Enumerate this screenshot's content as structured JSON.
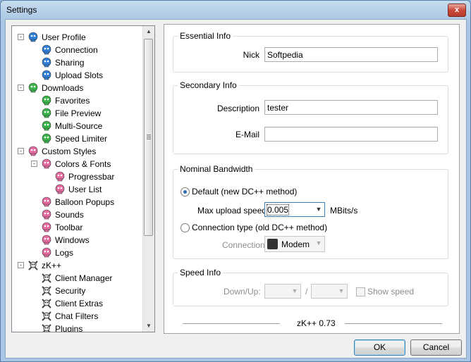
{
  "window": {
    "title": "Settings",
    "close_label": "x"
  },
  "tree": {
    "items": [
      {
        "label": "User Profile",
        "depth": 0,
        "icon": "blue-head-icon",
        "expander": "-"
      },
      {
        "label": "Connection",
        "depth": 1,
        "icon": "blue-head-icon"
      },
      {
        "label": "Sharing",
        "depth": 1,
        "icon": "blue-head-icon"
      },
      {
        "label": "Upload Slots",
        "depth": 1,
        "icon": "blue-head-icon"
      },
      {
        "label": "Downloads",
        "depth": 0,
        "icon": "green-skull-icon",
        "expander": "-"
      },
      {
        "label": "Favorites",
        "depth": 1,
        "icon": "green-skull-icon"
      },
      {
        "label": "File Preview",
        "depth": 1,
        "icon": "green-skull-icon"
      },
      {
        "label": "Multi-Source",
        "depth": 1,
        "icon": "green-skull-icon"
      },
      {
        "label": "Speed Limiter",
        "depth": 1,
        "icon": "green-skull-icon"
      },
      {
        "label": "Custom Styles",
        "depth": 0,
        "icon": "pink-skull-icon",
        "expander": "-"
      },
      {
        "label": "Colors & Fonts",
        "depth": 1,
        "icon": "pink-skull-icon",
        "expander": "-"
      },
      {
        "label": "Progressbar",
        "depth": 2,
        "icon": "pink-skull-icon"
      },
      {
        "label": "User List",
        "depth": 2,
        "icon": "pink-skull-icon"
      },
      {
        "label": "Balloon Popups",
        "depth": 1,
        "icon": "pink-skull-icon"
      },
      {
        "label": "Sounds",
        "depth": 1,
        "icon": "pink-skull-icon"
      },
      {
        "label": "Toolbar",
        "depth": 1,
        "icon": "pink-skull-icon"
      },
      {
        "label": "Windows",
        "depth": 1,
        "icon": "pink-skull-icon"
      },
      {
        "label": "Logs",
        "depth": 1,
        "icon": "pink-skull-icon"
      },
      {
        "label": "zK++",
        "depth": 0,
        "icon": "crossbones-icon",
        "expander": "-"
      },
      {
        "label": "Client Manager",
        "depth": 1,
        "icon": "crossbones-icon"
      },
      {
        "label": "Security",
        "depth": 1,
        "icon": "crossbones-icon"
      },
      {
        "label": "Client Extras",
        "depth": 1,
        "icon": "crossbones-icon"
      },
      {
        "label": "Chat Filters",
        "depth": 1,
        "icon": "crossbones-icon"
      },
      {
        "label": "Plugins",
        "depth": 1,
        "icon": "crossbones-icon"
      }
    ]
  },
  "essential": {
    "title": "Essential Info",
    "nick_label": "Nick",
    "nick_value": "Softpedia"
  },
  "secondary": {
    "title": "Secondary Info",
    "description_label": "Description",
    "description_value": "tester",
    "email_label": "E-Mail",
    "email_value": ""
  },
  "bandwidth": {
    "title": "Nominal Bandwidth",
    "default_label": "Default (new DC++ method)",
    "max_upload_label": "Max upload speed",
    "max_upload_value": "0.005",
    "units_label": "MBits/s",
    "conn_type_label": "Connection type (old DC++ method)",
    "connection_label": "Connection",
    "connection_value": "Modem"
  },
  "speed": {
    "title": "Speed Info",
    "downup_label": "Down/Up:",
    "slash": "/",
    "show_speed_label": "Show speed"
  },
  "footer": {
    "version": "zK++ 0.73"
  },
  "buttons": {
    "ok": "OK",
    "cancel": "Cancel"
  }
}
